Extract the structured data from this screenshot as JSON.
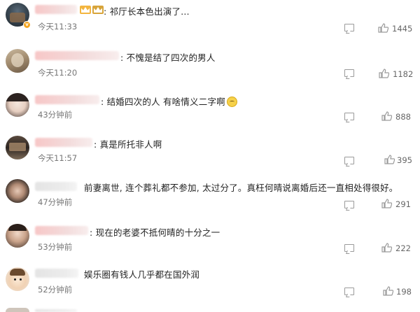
{
  "comments": [
    {
      "text": ": 祁厅长本色出演了…",
      "time": "今天11:33",
      "likes": "1445"
    },
    {
      "text": ": 不愧是结了四次的男人",
      "time": "今天11:20",
      "likes": "1182"
    },
    {
      "text": ": 结婚四次的人 有啥情义二字啊",
      "time": "43分钟前",
      "likes": "888"
    },
    {
      "text": ": 真是所托非人啊",
      "time": "今天11:57",
      "likes": "395"
    },
    {
      "text": "前妻离世, 连个葬礼都不参加, 太过分了。真枉何晴说离婚后还一直相处得很好。",
      "time": "47分钟前",
      "likes": "291"
    },
    {
      "text": ": 现在的老婆不抵何晴的十分之一",
      "time": "53分钟前",
      "likes": "222"
    },
    {
      "text": "娱乐圈有钱人几乎都在国外润",
      "time": "52分钟前",
      "likes": "198"
    }
  ],
  "icons": {
    "reply": "comment-icon",
    "like": "thumbs-up-icon",
    "vip": "crown-icon",
    "emoji": "smile-emoji-icon"
  },
  "colors": {
    "badge": "#f5a623",
    "name_blur": "#f3c9c9"
  }
}
